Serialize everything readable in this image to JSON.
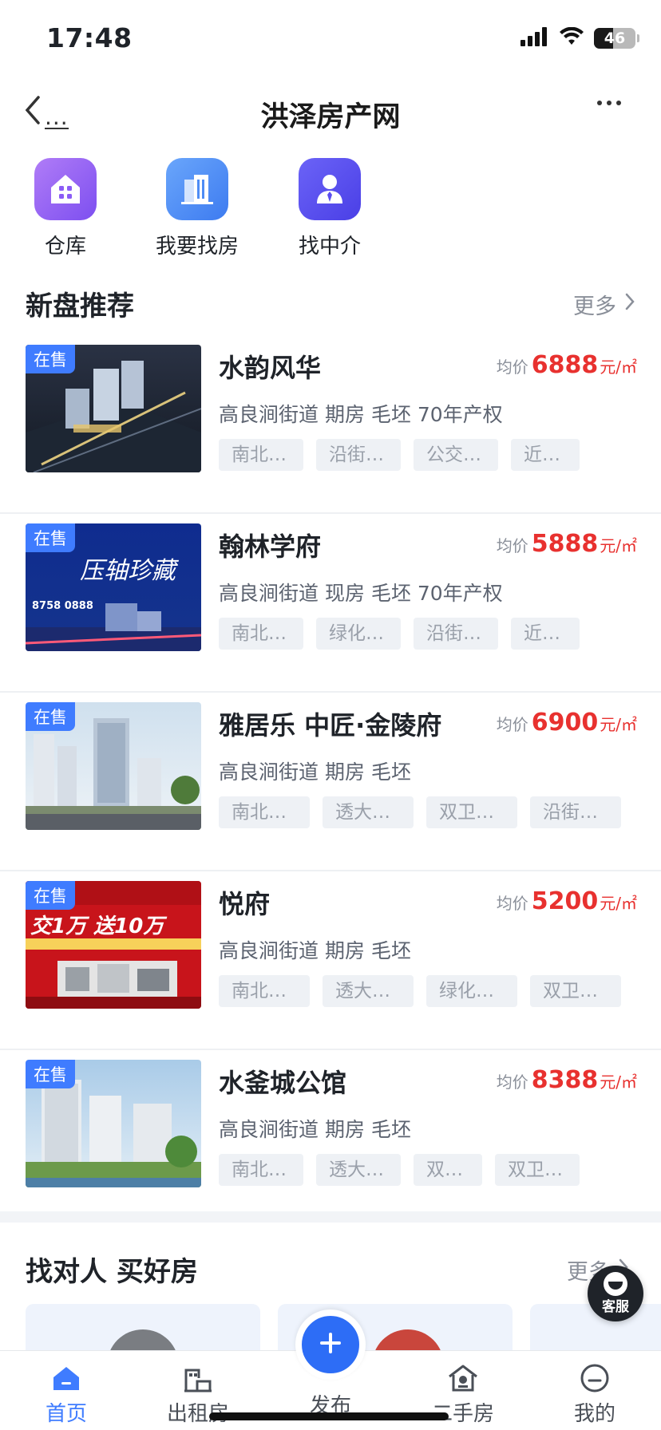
{
  "status_bar": {
    "time": "17:48",
    "battery": "46",
    "battery_level": 0.46
  },
  "nav": {
    "back_dots": "...",
    "title": "洪泽房产网"
  },
  "quick_entries": [
    {
      "label": "仓库",
      "icon": "warehouse-icon",
      "color": "#8b5cf6"
    },
    {
      "label": "我要找房",
      "icon": "building-icon",
      "color": "#4d8cf5"
    },
    {
      "label": "找中介",
      "icon": "agent-icon",
      "color": "#5b4df0"
    }
  ],
  "new_listings": {
    "title": "新盘推荐",
    "more": "更多",
    "items": [
      {
        "badge": "在售",
        "name": "水韵风华",
        "price_label": "均价",
        "price": "6888",
        "unit": "元/㎡",
        "attrs": "高良涧街道  期房  毛坯  70年产权",
        "tags": [
          "南北…",
          "沿街…",
          "公交…",
          "近…"
        ]
      },
      {
        "badge": "在售",
        "name": "翰林学府",
        "price_label": "均价",
        "price": "5888",
        "unit": "元/㎡",
        "attrs": "高良涧街道  现房  毛坯  70年产权",
        "tags": [
          "南北…",
          "绿化…",
          "沿街…",
          "近…"
        ],
        "thumb_text": "压轴珍藏",
        "thumb_phone": "8758 0888"
      },
      {
        "badge": "在售",
        "name": "雅居乐 中匠·金陵府",
        "price_label": "均价",
        "price": "6900",
        "unit": "元/㎡",
        "attrs": "高良涧街道  期房  毛坯",
        "tags": [
          "南北…",
          "透大…",
          "双卫…",
          "沿街…"
        ]
      },
      {
        "badge": "在售",
        "name": "悦府",
        "price_label": "均价",
        "price": "5200",
        "unit": "元/㎡",
        "attrs": "高良涧街道  期房  毛坯",
        "tags": [
          "南北…",
          "透大…",
          "绿化…",
          "双卫…"
        ],
        "thumb_text": "交1万 送10万"
      },
      {
        "badge": "在售",
        "name": "水釜城公馆",
        "price_label": "均价",
        "price": "8388",
        "unit": "元/㎡",
        "attrs": "高良涧街道  期房  毛坯",
        "tags": [
          "南北…",
          "透大…",
          "双…",
          "双卫…"
        ]
      }
    ]
  },
  "agents_section": {
    "title": "找对人 买好房",
    "more": "更多"
  },
  "service": {
    "label": "客服"
  },
  "tabbar": {
    "tabs": [
      {
        "label": "首页",
        "icon": "home-icon",
        "active": true
      },
      {
        "label": "出租房",
        "icon": "rent-icon",
        "active": false
      },
      {
        "label": "发布",
        "icon": "plus-icon",
        "active": false
      },
      {
        "label": "二手房",
        "icon": "house-icon",
        "active": false
      },
      {
        "label": "我的",
        "icon": "profile-icon",
        "active": false
      }
    ]
  },
  "colors": {
    "accent": "#3f7cff",
    "price": "#e8312f",
    "publish": "#2d6df6"
  }
}
